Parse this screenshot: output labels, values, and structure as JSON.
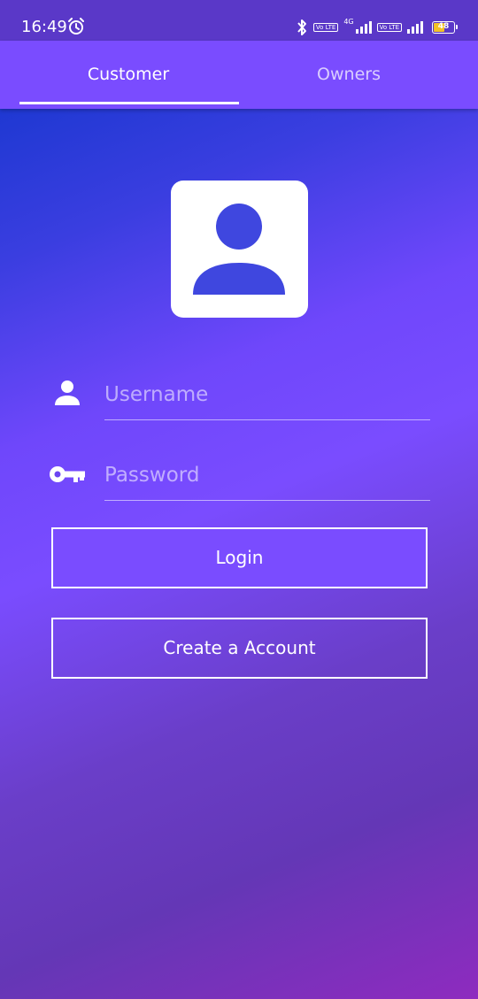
{
  "status_bar": {
    "time": "16:49",
    "network_label": "4G",
    "volte_badge": "Vo LTE",
    "battery_level": "48"
  },
  "tabs": [
    {
      "label": "Customer",
      "selected": true
    },
    {
      "label": "Owners",
      "selected": false
    }
  ],
  "form": {
    "username_placeholder": "Username",
    "password_placeholder": "Password",
    "login_label": "Login",
    "create_account_label": "Create a Account"
  },
  "icons": {
    "avatar": "person-icon",
    "username": "user-icon",
    "password": "key-icon"
  },
  "colors": {
    "accent": "#7a4cff",
    "status_bar": "#5a38c8",
    "avatar_fill": "#3f47df",
    "text": "#ffffff"
  }
}
